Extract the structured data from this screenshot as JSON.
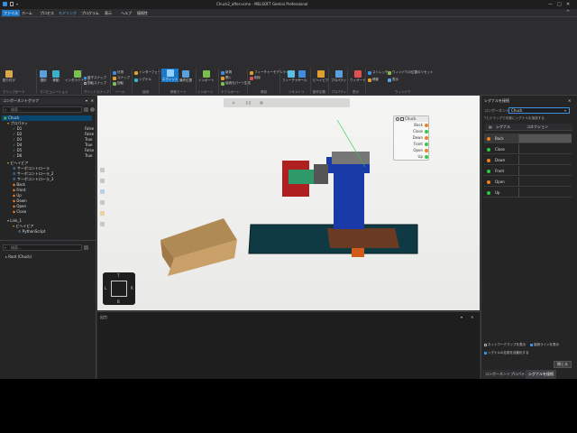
{
  "window": {
    "title": "Chuck2_after.vcmx - MELSOFT Gemini Professional",
    "controls": [
      "—",
      "□",
      "✕"
    ]
  },
  "menu": [
    {
      "label": "ファイル",
      "active": true
    },
    {
      "label": "ホーム"
    },
    {
      "label": "プロセス"
    },
    {
      "label": "モデリング"
    },
    {
      "label": "プログラム"
    },
    {
      "label": "表示"
    },
    {
      "label": "ヘルプ"
    },
    {
      "label": "接続性"
    }
  ],
  "ribbon": {
    "clipboard": {
      "group": "クリップボード",
      "paste": "貼り付け"
    },
    "manipulation": {
      "group": "マニピュレーション",
      "select": "選択",
      "move": "移動",
      "interactive": "インタラクティブ"
    },
    "grid": {
      "group": "グリッドスナップ",
      "grid_snap": "格子スナップ",
      "align": "回転スナップ"
    },
    "tools": {
      "group": "ツール",
      "measure": "計測",
      "snap": "スナップ",
      "rotate": "回転"
    },
    "connect": {
      "group": "接続",
      "interface": "インターフェース",
      "signal": "シグナル"
    },
    "sim": {
      "group": "移動モード",
      "edit": "エディット",
      "simulate": "最終位置"
    },
    "import": {
      "group": "インポート",
      "import": "インポート"
    },
    "export": {
      "group": "エクスポート",
      "new": "新規",
      "open": "開く",
      "generate": "接続元パーツ生成"
    },
    "structure": {
      "group": "構造",
      "items": [
        "フィーチャーモデルライト",
        "削除"
      ]
    },
    "geometry": {
      "group": "ジオメトリ",
      "feature": "フィーチャー",
      "tool": "ツール"
    },
    "behavior": {
      "group": "動作定義",
      "behavior": "ビヘイビア"
    },
    "property": {
      "group": "プロパティ",
      "property": "プロパティ"
    },
    "display": {
      "group": "表示",
      "wizard": "ウィザード"
    },
    "window": {
      "group": "ウィンドウ",
      "items": [
        "ストレッチ",
        "ウィンドウの位置のリセット",
        "移動",
        "表示"
      ]
    }
  },
  "component_graph": {
    "title": "コンポーネントグラフ",
    "search_placeholder": "検索...",
    "rows": [
      {
        "label": "Chuck",
        "indent": 0,
        "selected": true
      },
      {
        "label": "プロパティ",
        "indent": 1
      },
      {
        "label": "D1",
        "value": "False",
        "indent": 2,
        "tick": true
      },
      {
        "label": "D2",
        "value": "False",
        "indent": 2,
        "tick": true
      },
      {
        "label": "D3",
        "value": "True",
        "indent": 2,
        "tick": true
      },
      {
        "label": "D4",
        "value": "True",
        "indent": 2,
        "tick": true
      },
      {
        "label": "D5",
        "value": "False",
        "indent": 2,
        "tick": true
      },
      {
        "label": "D6",
        "value": "True",
        "indent": 2,
        "tick": true
      },
      {
        "label": "ビヘイビア",
        "indent": 1
      },
      {
        "label": "サーボコントローラ",
        "indent": 2
      },
      {
        "label": "サーボコントローラ_2",
        "indent": 2
      },
      {
        "label": "サーボコントローラ_3",
        "indent": 2
      },
      {
        "label": "Back",
        "indent": 2
      },
      {
        "label": "Front",
        "indent": 2
      },
      {
        "label": "Up",
        "indent": 2
      },
      {
        "label": "Down",
        "indent": 2
      },
      {
        "label": "Open",
        "indent": 2
      },
      {
        "label": "Close",
        "indent": 2
      },
      {
        "label": "Link_1",
        "indent": 1
      },
      {
        "label": "ビヘイビア",
        "indent": 2
      },
      {
        "label": "PythonScript",
        "indent": 3
      }
    ]
  },
  "cell_graph": {
    "search_placeholder": "検索...",
    "rows": [
      {
        "label": "Root (Chuck)"
      }
    ]
  },
  "viewport": {
    "chuck_node": {
      "title": "Chuck",
      "signals": [
        {
          "label": "Back",
          "color": "#f08020"
        },
        {
          "label": "Close",
          "color": "#2ecc40"
        },
        {
          "label": "Down",
          "color": "#f08020"
        },
        {
          "label": "Front",
          "color": "#2ecc40"
        },
        {
          "label": "Open",
          "color": "#f08020"
        },
        {
          "label": "Up",
          "color": "#2ecc40"
        }
      ]
    },
    "nav_cube": {
      "top": "T",
      "left": "L",
      "right": "R",
      "bottom": "B"
    }
  },
  "output": {
    "title": "出力"
  },
  "signals_panel": {
    "title": "シグナルを接続",
    "component_label": "コンポーネント",
    "component_value": "Chuck",
    "hint": "Tとドラッグで対象にシグナルを接続する",
    "col_signal": "シグナル",
    "col_connection": "コネクション",
    "rows": [
      {
        "label": "Back",
        "color": "#f08020",
        "selected": true
      },
      {
        "label": "Close",
        "color": "#2ecc40"
      },
      {
        "label": "Down",
        "color": "#f08020"
      },
      {
        "label": "Front",
        "color": "#2ecc40"
      },
      {
        "label": "Open",
        "color": "#f08020"
      },
      {
        "label": "Up",
        "color": "#2ecc40"
      }
    ],
    "opt1": "ネットワークマップを表示",
    "opt2": "接続ラインを表示",
    "opt3": "シグナルの名前を自動化する",
    "close_button": "閉じる"
  },
  "bottom_tabs": [
    "コンポーネントプロパティ",
    "シグナルを接続"
  ],
  "colors": {
    "accent": "#1e78c8",
    "panel": "#252526",
    "orange": "#f08020",
    "green": "#2ecc40"
  }
}
